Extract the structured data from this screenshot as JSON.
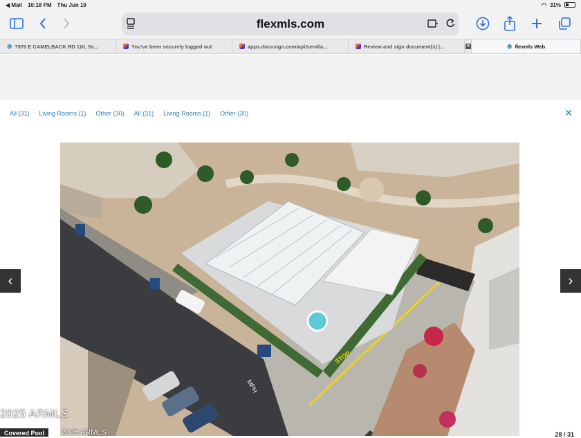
{
  "status": {
    "back_app": "◀ Mail",
    "time": "10:18 PM",
    "date": "Thu Jun 19",
    "battery": "31%",
    "battery_level": 0.31
  },
  "browser": {
    "url": "flexmls.com",
    "tabs": [
      {
        "label": "7970 E CAMELBACK RD 110, Sc..."
      },
      {
        "label": "You've been securely logged out"
      },
      {
        "label": "apps.docusign.com/api/send/a..."
      },
      {
        "label": "Review and sign document(s) |..."
      },
      {
        "label": ""
      },
      {
        "label": "flexmls Web"
      }
    ]
  },
  "viewer": {
    "filters": [
      "All (31)",
      "Living Rooms (1)",
      "Other (30)",
      "All (31)",
      "Living Rooms (1)",
      "Other (30)"
    ],
    "close_label": "✕",
    "prev_label": "‹",
    "next_label": "›",
    "watermark": "2025 ARMLS",
    "watermark_small": "2025 ARMLS",
    "caption": "Covered Pool",
    "counter": "28 / 31",
    "street_text": "STOP",
    "road_text": "MPH"
  },
  "icons": {
    "sidebar": "sidebar-icon",
    "back": "chevron-left-icon",
    "forward": "chevron-right-icon",
    "reader": "reader-icon",
    "reload": "reload-icon",
    "download": "download-icon",
    "share": "share-icon",
    "new_tab": "plus-icon",
    "tabs": "tabs-icon"
  },
  "colors": {
    "accent": "#2f6fdf",
    "link": "#2f7fb5"
  }
}
